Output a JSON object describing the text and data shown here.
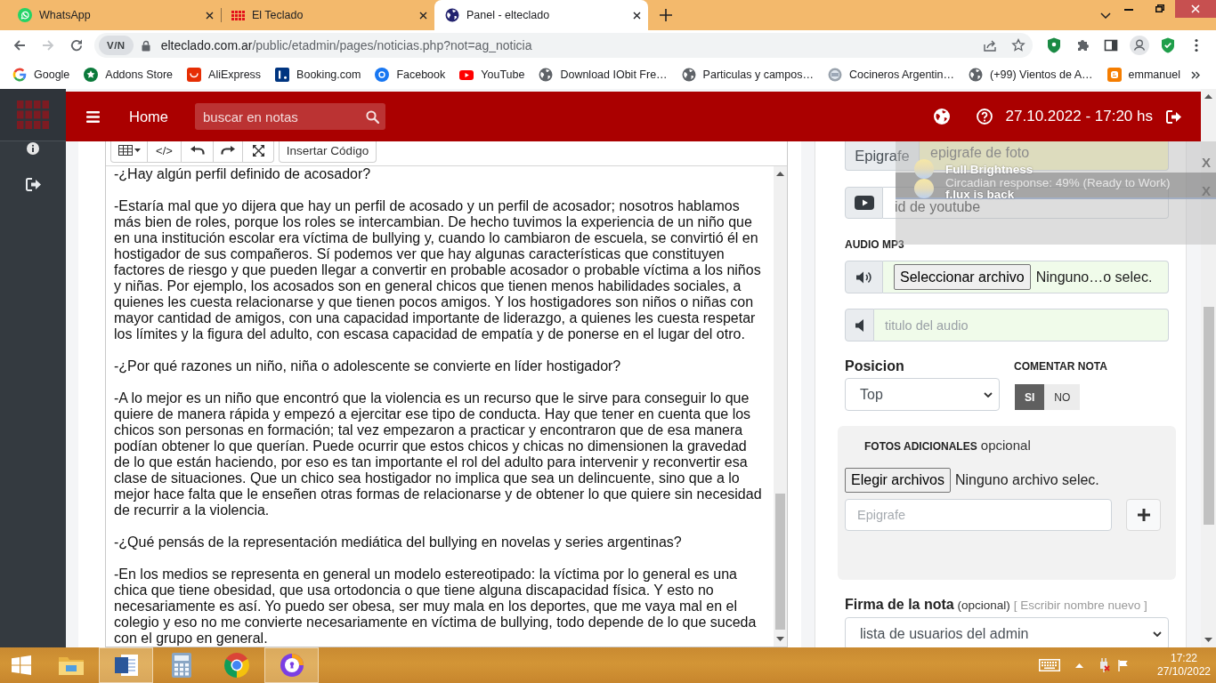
{
  "browser": {
    "tabs": [
      {
        "title": "WhatsApp",
        "selected": false
      },
      {
        "title": "El Teclado",
        "selected": false
      },
      {
        "title": "Panel - elteclado",
        "selected": true
      }
    ],
    "nav_buttons": [
      {
        "disabled": false
      },
      {
        "disabled": true
      },
      {
        "disabled": false
      }
    ],
    "address": {
      "badge": "V/N",
      "domain": "elteclado.com.ar",
      "path": "/public/etadmin/pages/noticias.php?not=ag_noticia"
    },
    "bookmarks": [
      "Google",
      "Addons Store",
      "AliExpress",
      "Booking.com",
      "Facebook",
      "YouTube",
      "Download IObit Fre…",
      "Particulas y campos…",
      "Cocineros Argentin…",
      "(+99) Vientos de A…",
      "emmanuel"
    ]
  },
  "panel": {
    "header": {
      "home": "Home",
      "search": {
        "placeholder": "buscar en notas"
      },
      "datetime": "27.10.2022 - 17:20 hs"
    },
    "editor": {
      "toolbar": {
        "code_button": "</>",
        "insert_code_button": "Insertar Código"
      },
      "paragraphs": [
        "-¿Hay algún perfil definido de acosador?",
        "-Estaría mal que yo dijera que hay un perfil de acosado y un perfil de acosador; nosotros hablamos más bien de roles, porque los roles se intercambian. De hecho tuvimos la experiencia de un niño que en una institución escolar era víctima de bullying y, cuando lo cambiaron de escuela, se convirtió él en hostigador de sus compañeros. Sí podemos ver que hay algunas características que constituyen factores de riesgo y que pueden llegar a convertir en probable acosador o probable víctima a los niños y niñas. Por ejemplo, los acosados son en general chicos que tienen menos habilidades sociales, a quienes les cuesta relacionarse y que tienen pocos amigos. Y los hostigadores son niños o niñas con mayor cantidad de amigos, con una capacidad importante de liderazgo, a quienes les cuesta respetar los límites y la figura del adulto, con escasa capacidad de empatía y de ponerse en el lugar del otro.",
        "-¿Por qué razones un niño, niña o adolescente se convierte en líder hostigador?",
        "-A lo mejor es un niño que encontró que la violencia es un recurso que le sirve para conseguir lo que quiere de manera rápida y empezó a ejercitar ese tipo de conducta. Hay que tener en cuenta que los chicos son personas en formación; tal vez empezaron a practicar y encontraron que de esa manera podían obtener lo que querían. Puede ocurrir que estos chicos y chicas no dimensionen la gravedad de lo que están haciendo, por eso es tan importante el rol del adulto para intervenir y reconvertir esa clase de situaciones. Que un chico sea hostigador no implica que sea un delincuente, sino que a lo mejor hace falta que le enseñen otras formas de relacionarse y de obtener lo que quiere sin necesidad de recurrir a la violencia.",
        "-¿Qué pensás de la representación mediática del bullying en novelas y series argentinas?",
        "-En los medios se representa en general un modelo estereotipado: la víctima por lo general es una chica que tiene obesidad, que usa ortodoncia o que tiene alguna discapacidad física. Y esto no necesariamente es así. Yo puedo ser obesa, ser muy mala en los deportes, que me vaya mal en el colegio y eso no me convierte necesariamente en víctima de bullying, todo depende de lo que suceda con el grupo en general."
      ]
    },
    "form": {
      "caption": {
        "addon": "Epigrafe",
        "placeholder": "epigrafe de foto"
      },
      "youtube": {
        "placeholder": "id de youtube"
      },
      "audio": {
        "label": "AUDIO MP3",
        "file_button": "Seleccionar archivo",
        "file_status": "Ninguno…o selec.",
        "title_placeholder": "titulo del audio"
      },
      "position": {
        "label": "Posicion",
        "value": "Top"
      },
      "comments": {
        "label": "COMENTAR NOTA",
        "options": [
          {
            "label": "SI",
            "selected": true
          },
          {
            "label": "NO",
            "selected": false
          }
        ]
      },
      "extra_photos": {
        "heading": "**FOTOS ADICIONALES** opcional",
        "file_button": "Elegir archivos",
        "file_status": "Ninguno archivo selec.",
        "caption_placeholder": "Epigrafe"
      },
      "signature": {
        "label": "**Firma de la nota** (opcional)",
        "link": "[ Escribir nombre nuevo ]",
        "value": "lista de usuarios del admin"
      }
    }
  },
  "notifications": [
    {
      "title": "Full Brightness",
      "message": "Circadian response: 49% (Ready to Work)",
      "close": "X"
    },
    {
      "title": "f.lux is back",
      "close": "X"
    }
  ],
  "taskbar": {
    "apps": [
      {
        "selected": false
      },
      {
        "selected": true
      },
      {
        "selected": false
      },
      {
        "selected": false
      },
      {
        "selected": true
      }
    ],
    "time": "17:22",
    "date": "27/10/2022"
  }
}
